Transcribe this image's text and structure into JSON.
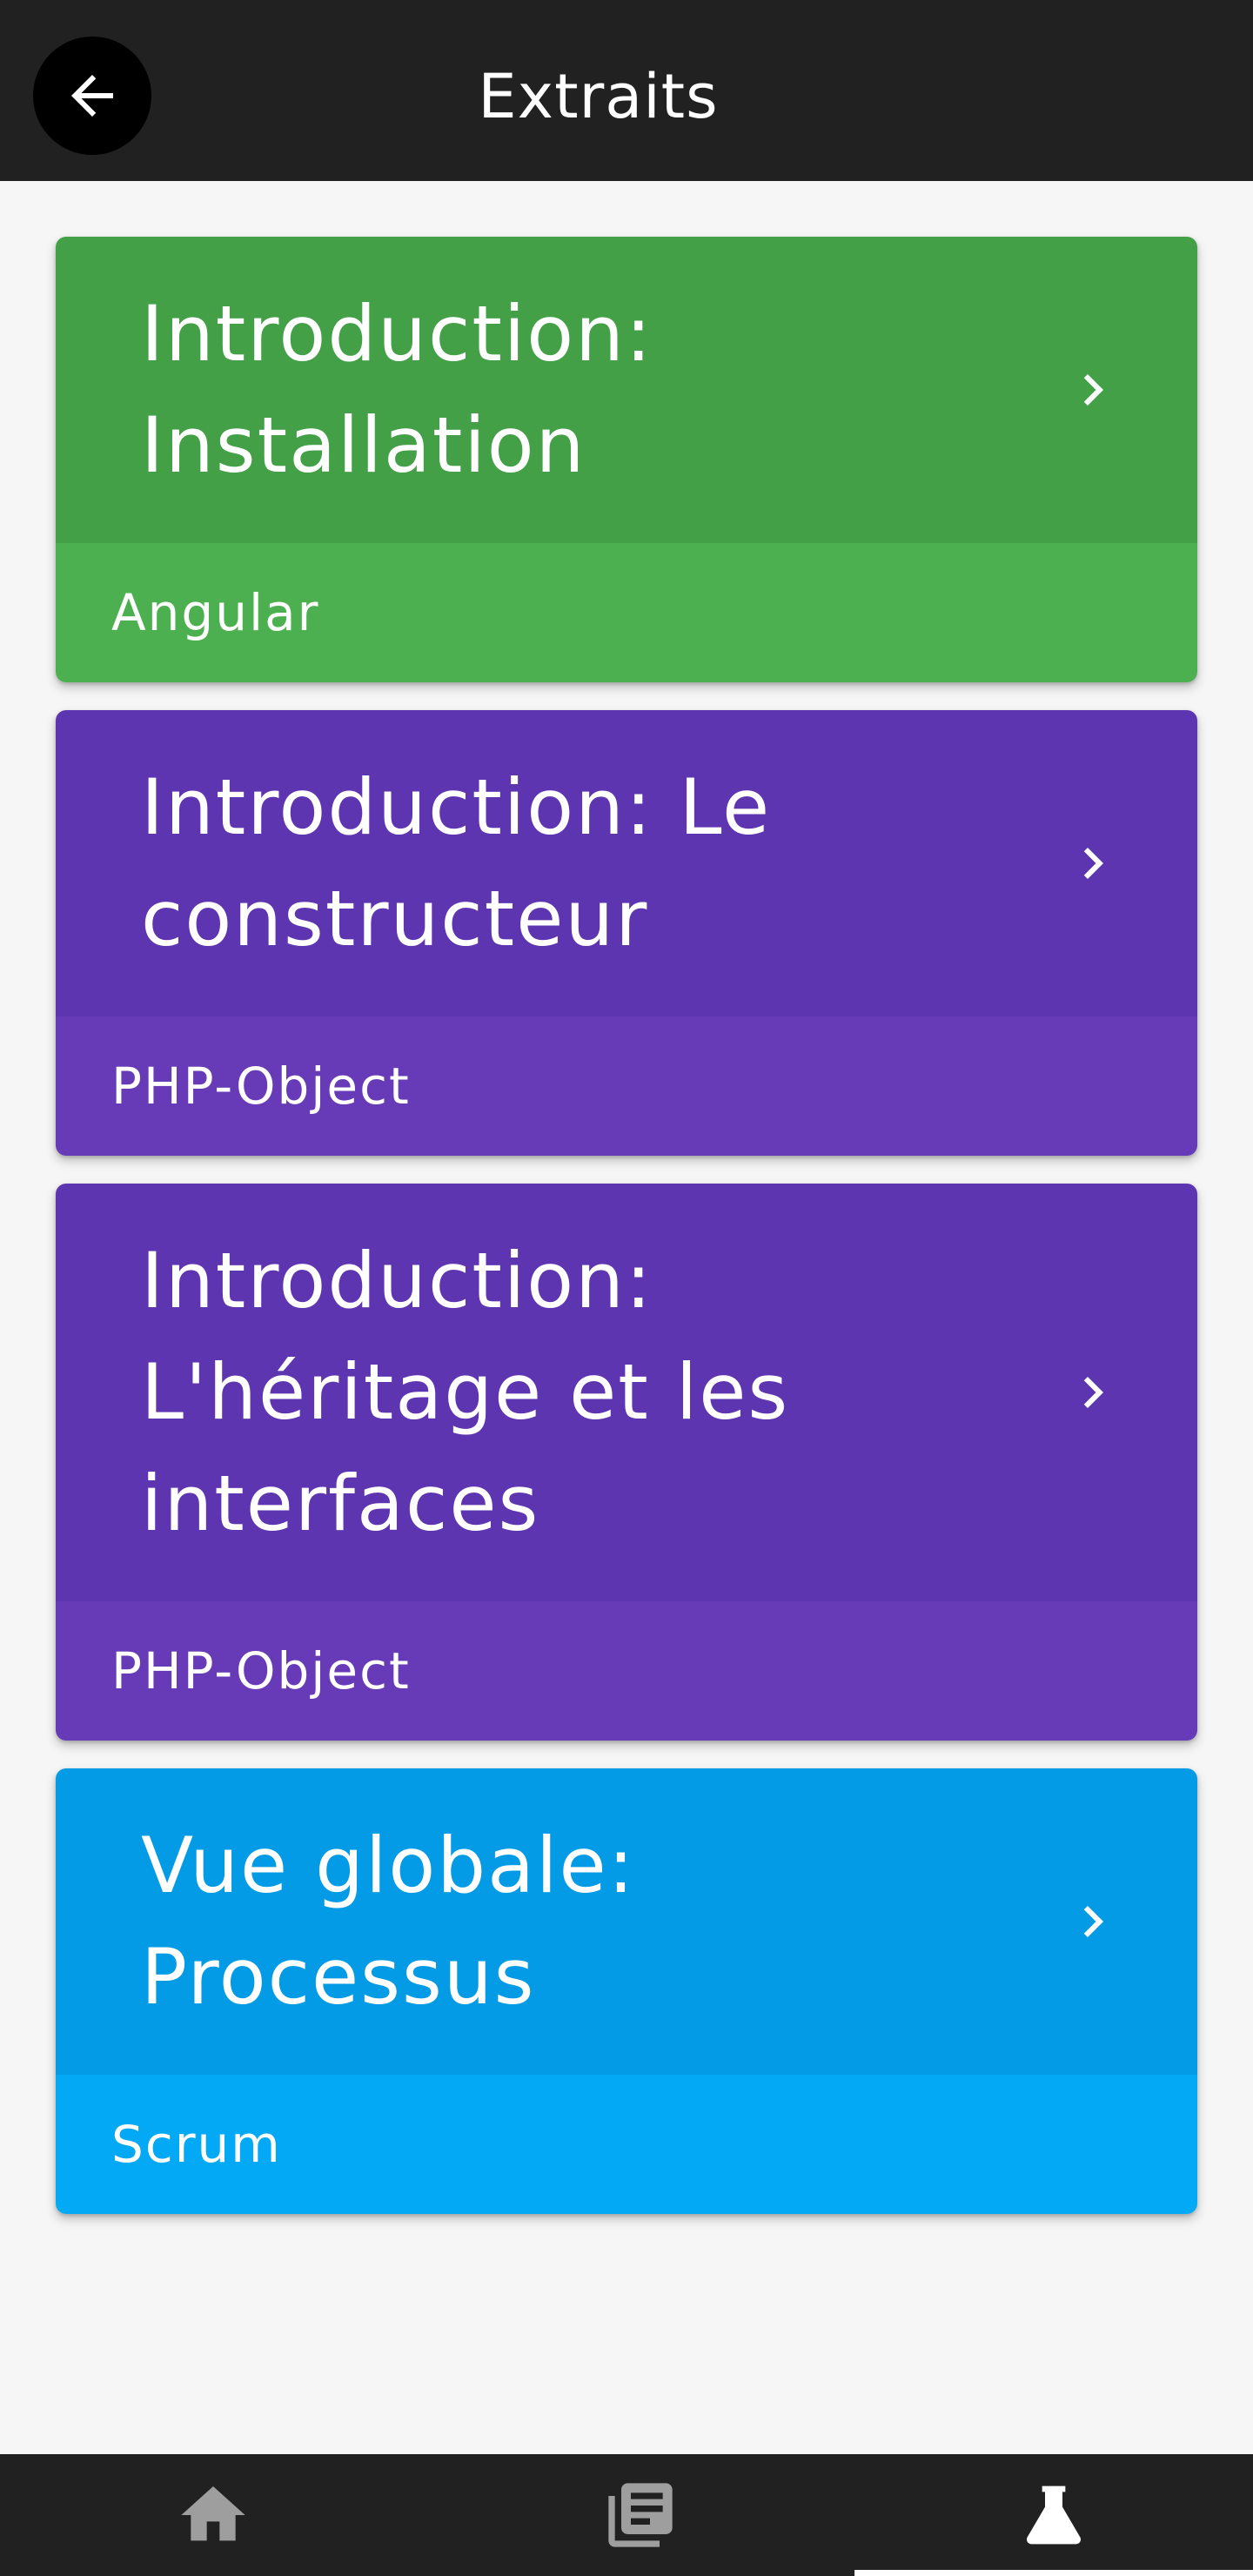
{
  "app_bar": {
    "title": "Extraits",
    "back_icon": "arrow-left-icon"
  },
  "cards": [
    {
      "title": "Introduction: Installation",
      "category": "Angular",
      "head_color": "#43a047",
      "foot_color": "#4caf50"
    },
    {
      "title": "Introduction: Le constructeur",
      "category": "PHP-Object",
      "head_color": "#5e35b1",
      "foot_color": "#673ab7"
    },
    {
      "title": "Introduction: L'héritage et les interfaces",
      "category": "PHP-Object",
      "head_color": "#5e35b1",
      "foot_color": "#673ab7"
    },
    {
      "title": "Vue globale: Processus",
      "category": "Scrum",
      "head_color": "#039be5",
      "foot_color": "#03a9f4"
    }
  ],
  "bottom_nav": {
    "items": [
      {
        "icon": "home-icon",
        "active": false
      },
      {
        "icon": "library-books-icon",
        "active": false
      },
      {
        "icon": "flask-icon",
        "active": true
      }
    ]
  }
}
